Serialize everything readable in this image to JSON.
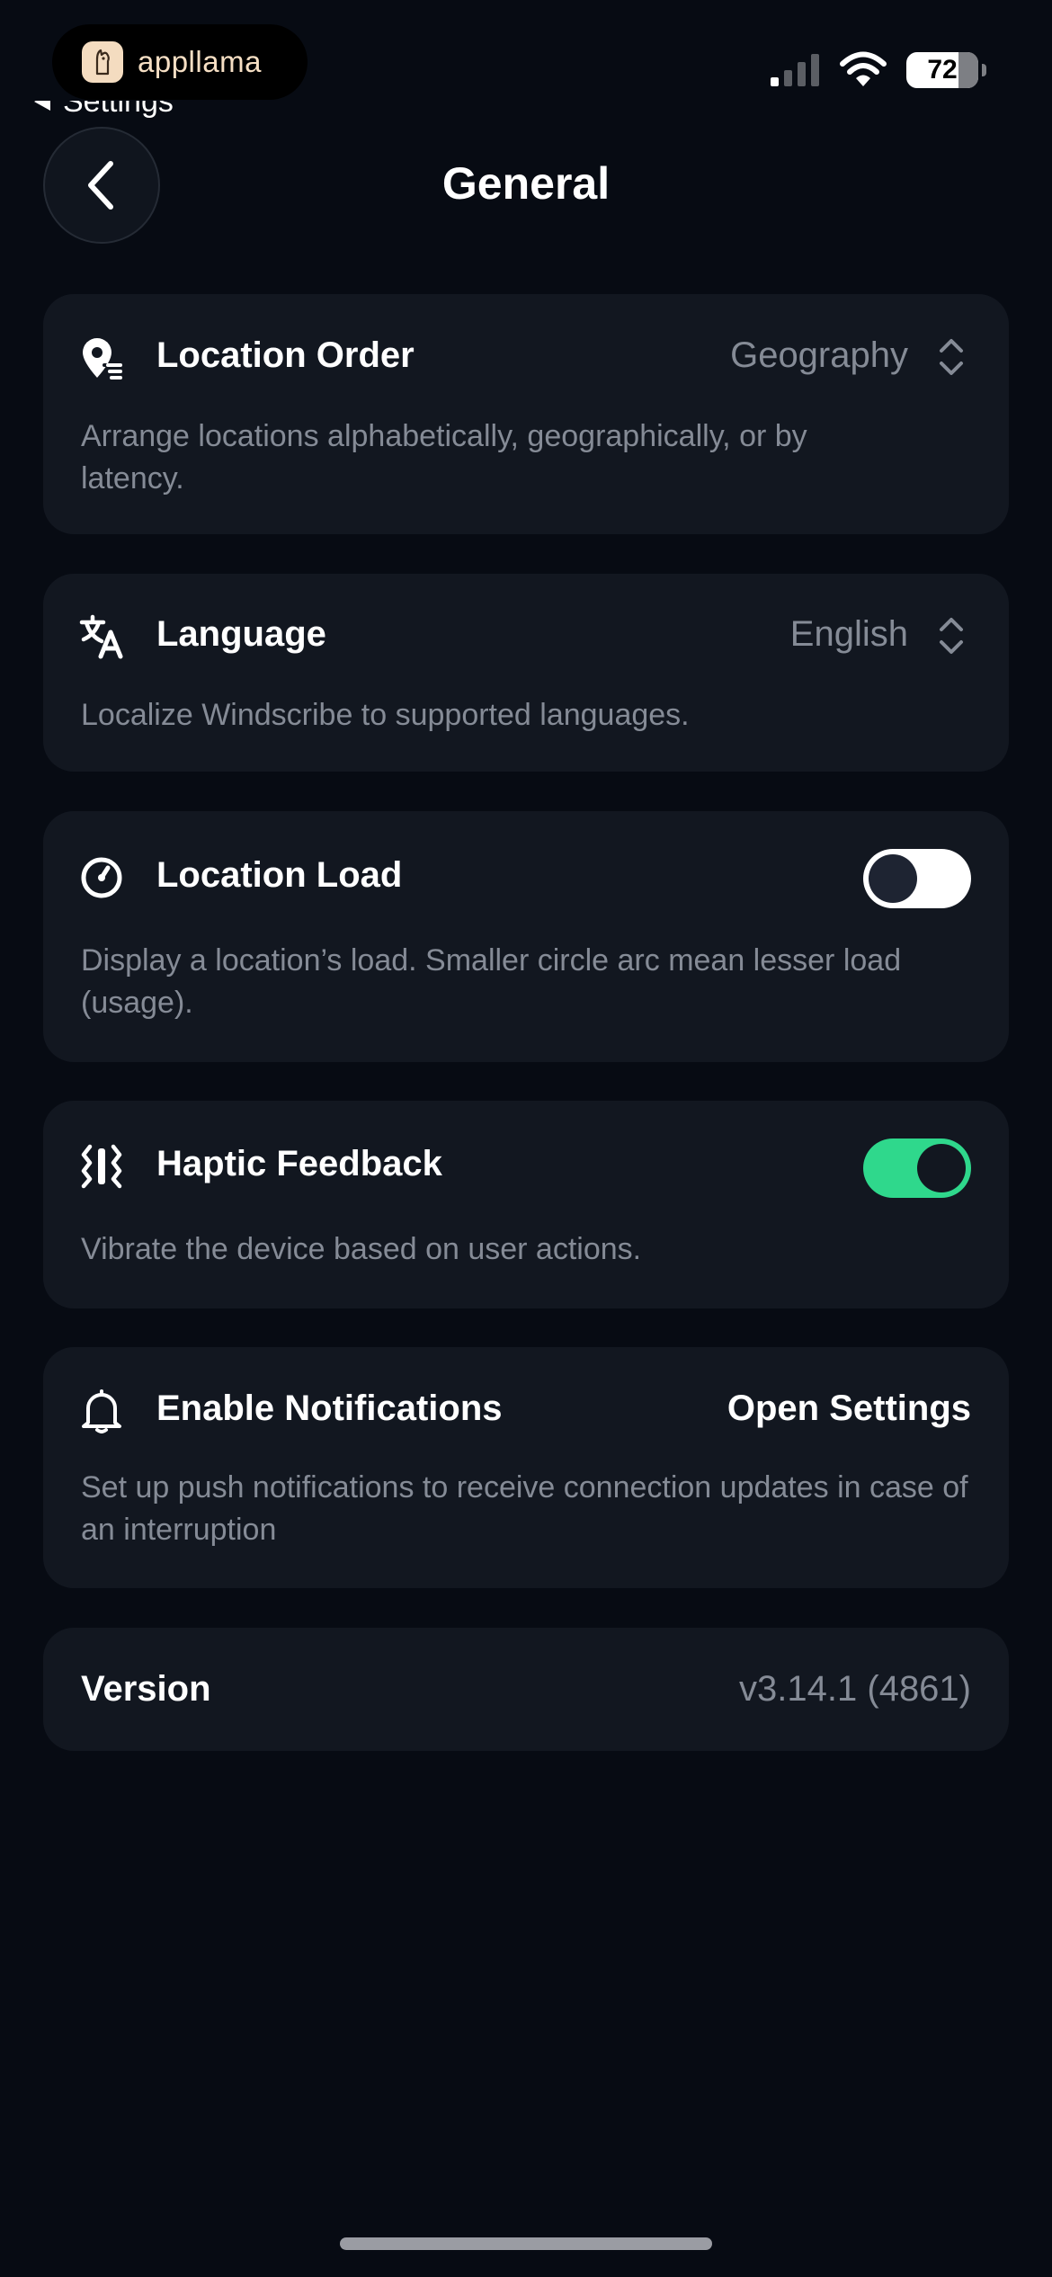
{
  "status_bar": {
    "app_name": "appllama",
    "back_link": "Settings",
    "battery": "72",
    "icons": [
      "cellular-signal-icon",
      "wifi-icon",
      "battery-icon"
    ]
  },
  "header": {
    "title": "General",
    "back_icon": "chevron-left-icon"
  },
  "settings": {
    "location_order": {
      "title": "Location Order",
      "value": "Geography",
      "description": "Arrange locations alphabetically, geographically, or by latency.",
      "icon": "location-pin-sort-icon"
    },
    "language": {
      "title": "Language",
      "value": "English",
      "description": "Localize Windscribe to supported languages.",
      "icon": "translate-icon"
    },
    "location_load": {
      "title": "Location Load",
      "enabled": false,
      "description": "Display a location’s load. Smaller circle arc mean lesser load (usage).",
      "icon": "gauge-icon"
    },
    "haptic_feedback": {
      "title": "Haptic Feedback",
      "enabled": true,
      "description": "Vibrate the device based on user actions.",
      "icon": "vibration-icon"
    },
    "notifications": {
      "title": "Enable Notifications",
      "action": "Open Settings",
      "description": "Set up push notifications to receive connection updates in case of an interruption",
      "icon": "bell-icon"
    },
    "version": {
      "label": "Version",
      "value": "v3.14.1 (4861)"
    }
  },
  "colors": {
    "background": "#070b13",
    "card": "#121720",
    "muted_text": "#858b96",
    "toggle_on": "#2fd88c"
  }
}
